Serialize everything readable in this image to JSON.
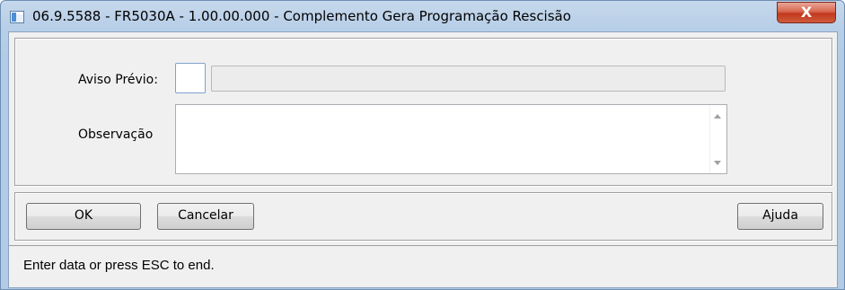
{
  "window": {
    "title": "06.9.5588 - FR5030A - 1.00.00.000 - Complemento Gera Programação Rescisão",
    "title_icon": "window-app-icon",
    "close_label": "X",
    "close_icon": "close-icon",
    "close_color": "#c2391d"
  },
  "form": {
    "aviso_label": "Aviso Prévio:",
    "aviso_value": "",
    "aviso_description": "",
    "observacao_label": "Observação",
    "observacao_value": ""
  },
  "buttons": {
    "ok_label": "OK",
    "cancel_label": "Cancelar",
    "help_label": "Ajuda"
  },
  "status": {
    "text": "Enter data or press ESC to end."
  }
}
